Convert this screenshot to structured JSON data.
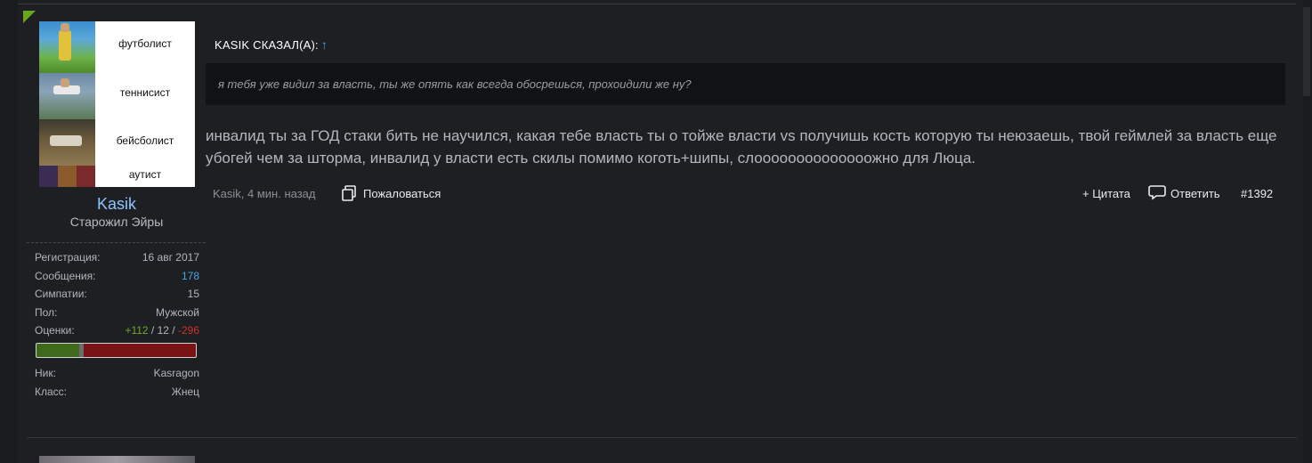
{
  "avatar": {
    "labels": [
      "футболист",
      "теннисист",
      "бейсболист",
      "аутист"
    ]
  },
  "user": {
    "name": "Kasik",
    "title": "Старожил Эйры"
  },
  "stats": {
    "registration": {
      "label": "Регистрация:",
      "value": "16 авг 2017"
    },
    "messages": {
      "label": "Сообщения:",
      "value": "178"
    },
    "likes": {
      "label": "Симпатии:",
      "value": "15"
    },
    "gender": {
      "label": "Пол:",
      "value": "Мужской"
    },
    "ratings": {
      "label": "Оценки:",
      "positive": "+112",
      "neutral": "12",
      "negative": "-296",
      "separator": " / "
    },
    "rating_bar": {
      "positive_fraction": 0.266,
      "neutral_fraction": 0.028,
      "negative_fraction": 0.706
    },
    "nick": {
      "label": "Ник:",
      "value": "Kasragon"
    },
    "class": {
      "label": "Класс:",
      "value": "Жнец"
    }
  },
  "quote": {
    "header": "KASIK СКАЗАЛ(А):",
    "arrow": "↑",
    "text": "я тебя уже видил за власть, ты же опять как всегда обосрешься, прохоидили же ну?"
  },
  "message": {
    "text": "инвалид ты за ГОД стаки бить не научился, какая тебе власть ты о тойже власти vs получишь кость которую ты неюзаешь, твой геймлей за власть еще убогей чем за шторма, инвалид у власти есть скилы помимо коготь+шипы, слоооооооооооооожно для Люца."
  },
  "meta": {
    "author_time": "Kasik, 4 мин. назад",
    "report_label": "Пожаловаться",
    "quote_label": "+ Цитата",
    "reply_label": "Ответить",
    "post_number": "#1392"
  },
  "colors": {
    "background": "#1d1f23",
    "accent_link": "#4aa3df",
    "username": "#8ec4ff",
    "positive": "#6eaa2c",
    "negative": "#d0302a",
    "corner_marker": "#6aa51b"
  }
}
